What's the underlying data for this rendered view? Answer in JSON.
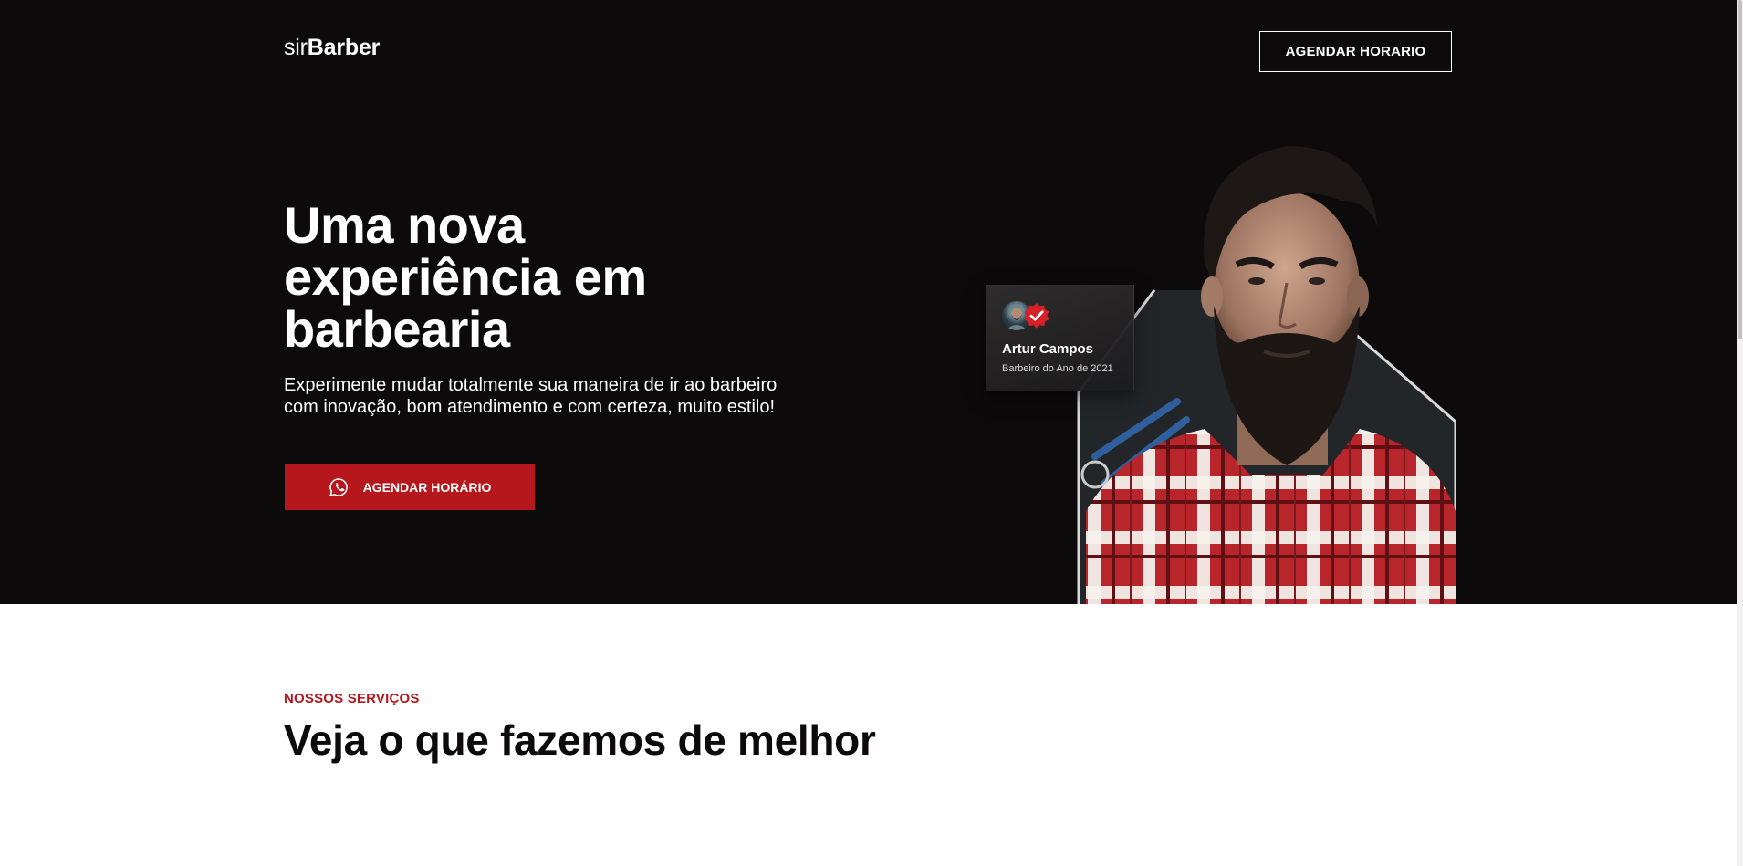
{
  "header": {
    "logo_light": "sir",
    "logo_bold": "Barber",
    "cta_label": "AGENDAR HORARIO"
  },
  "hero": {
    "title": "Uma nova experiência em barbearia",
    "subtitle": "Experimente mudar totalmente sua maneira de ir ao barbeiro com inovação, bom atendimento e com certeza, muito estilo!",
    "cta_label": "AGENDAR HORÁRIO",
    "cta_icon": "whatsapp-icon"
  },
  "badge": {
    "name": "Artur Campos",
    "role": "Barbeiro do Ano de 2021",
    "icon": "verified-check-icon"
  },
  "services": {
    "eyebrow": "NOSSOS SERVIÇOS",
    "title": "Veja o que fazemos de melhor"
  },
  "colors": {
    "hero_bg": "#0c0a0b",
    "accent": "#b5171c",
    "text_light": "#ffffff",
    "text_dark": "#0c0a0b"
  }
}
